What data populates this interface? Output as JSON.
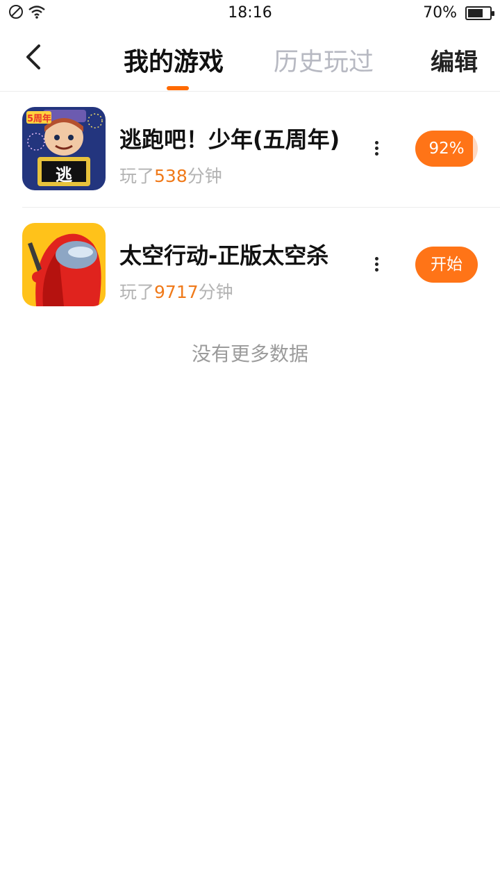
{
  "status_bar": {
    "time": "18:16",
    "battery_text": "70%",
    "battery_level": 0.7,
    "icons": [
      "no-sim-icon",
      "wifi-icon",
      "battery-icon"
    ]
  },
  "nav": {
    "tabs": [
      {
        "label": "我的游戏",
        "active": true
      },
      {
        "label": "历史玩过",
        "active": false
      }
    ],
    "edit_label": "编辑",
    "accent_color": "#ff6a00"
  },
  "games": [
    {
      "title": "逃跑吧！少年(五周年)",
      "played_prefix": "玩了",
      "played_minutes": "538",
      "played_suffix": "分钟",
      "button_label": "92%",
      "download_progress": 0.92,
      "icon": "escape-game-icon",
      "icon_badge": "5周年",
      "icon_tag": "逃"
    },
    {
      "title": "太空行动-正版太空杀",
      "played_prefix": "玩了",
      "played_minutes": "9717",
      "played_suffix": "分钟",
      "button_label": "开始",
      "icon": "space-action-game-icon"
    }
  ],
  "footer_text": "没有更多数据"
}
